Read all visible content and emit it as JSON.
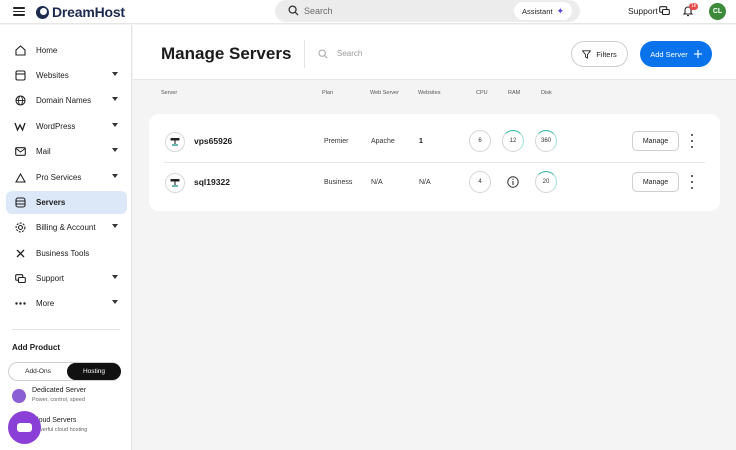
{
  "app": {
    "logo_text": "DreamHost"
  },
  "topbar": {
    "search_placeholder": "Search",
    "assistant_label": "Assistant",
    "support_label": "Support",
    "notification_count": "1k",
    "avatar_initials": "CL"
  },
  "sidebar": {
    "items": [
      {
        "label": "Home",
        "icon": "home-icon"
      },
      {
        "label": "Websites",
        "icon": "browser-icon"
      },
      {
        "label": "Domain Names",
        "icon": "globe-icon"
      },
      {
        "label": "WordPress",
        "icon": "wordpress-icon"
      },
      {
        "label": "Mail",
        "icon": "mail-icon"
      },
      {
        "label": "Pro Services",
        "icon": "pro-services-icon"
      },
      {
        "label": "Servers",
        "icon": "database-icon"
      },
      {
        "label": "Billing & Account",
        "icon": "gear-icon"
      },
      {
        "label": "Business Tools",
        "icon": "tools-icon"
      },
      {
        "label": "Support",
        "icon": "chat-icon"
      },
      {
        "label": "More",
        "icon": "more-icon"
      }
    ],
    "add_product": {
      "title": "Add Product",
      "tabs": [
        "Add-Ons",
        "Hosting"
      ],
      "products": [
        {
          "title": "Dedicated Server",
          "subtitle": "Power, control, speed"
        },
        {
          "title": "Cloud Servers",
          "subtitle": "Powerful cloud hosting"
        }
      ]
    }
  },
  "main": {
    "title": "Manage Servers",
    "search_placeholder": "Search",
    "filters_label": "Filters",
    "add_server_label": "Add Server",
    "columns": [
      "Server",
      "Plan",
      "Web Server",
      "Websites",
      "CPU",
      "RAM",
      "Disk"
    ],
    "rows": [
      {
        "name": "vps65926",
        "plan": "Premier",
        "web_server": "Apache",
        "websites": "1",
        "cpu": "6",
        "ram": "12",
        "disk": "360",
        "action": "Manage"
      },
      {
        "name": "sql19322",
        "plan": "Business",
        "web_server": "N/A",
        "websites": "N/A",
        "cpu": "4",
        "ram": "",
        "disk": "20",
        "action": "Manage"
      }
    ]
  },
  "colors": {
    "accent": "#0a73eb",
    "active_nav": "#dce8f8",
    "gauge": "#25b6a0",
    "fab": "#8a3fd6"
  }
}
